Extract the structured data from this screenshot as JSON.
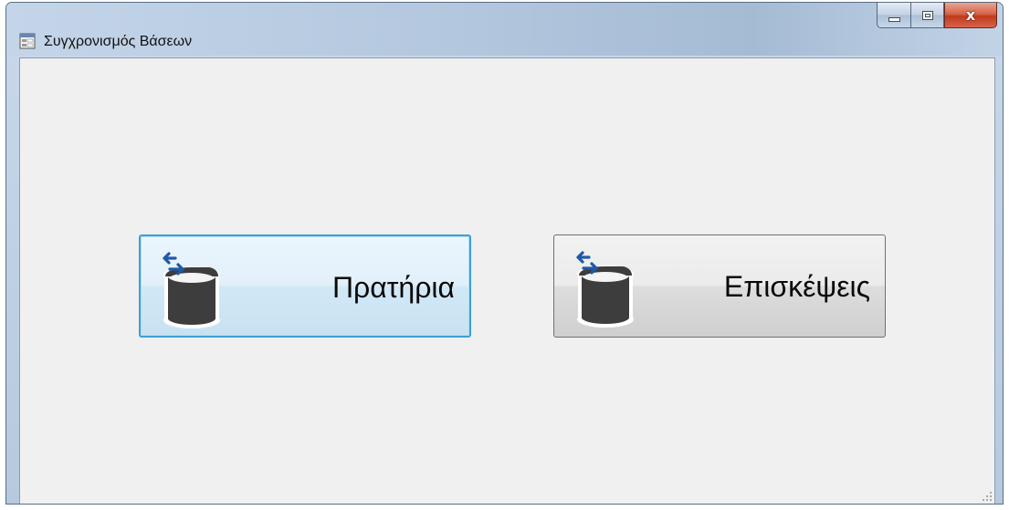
{
  "window": {
    "title": "Συγχρονισμός Βάσεων",
    "icon": "form-window-icon"
  },
  "controls": {
    "minimize_icon": "minimize-icon",
    "maximize_icon": "maximize-icon",
    "close_icon": "close-icon",
    "close_glyph": "x"
  },
  "buttons": [
    {
      "label": "Πρατήρια",
      "icon": "database-sync-icon",
      "focused": true
    },
    {
      "label": "Επισκέψεις",
      "icon": "database-sync-icon",
      "focused": false
    }
  ],
  "colors": {
    "focus_border": "#3c9fd8",
    "icon_arrow": "#1f5aa8",
    "icon_cylinder": "#3d3d3d"
  }
}
